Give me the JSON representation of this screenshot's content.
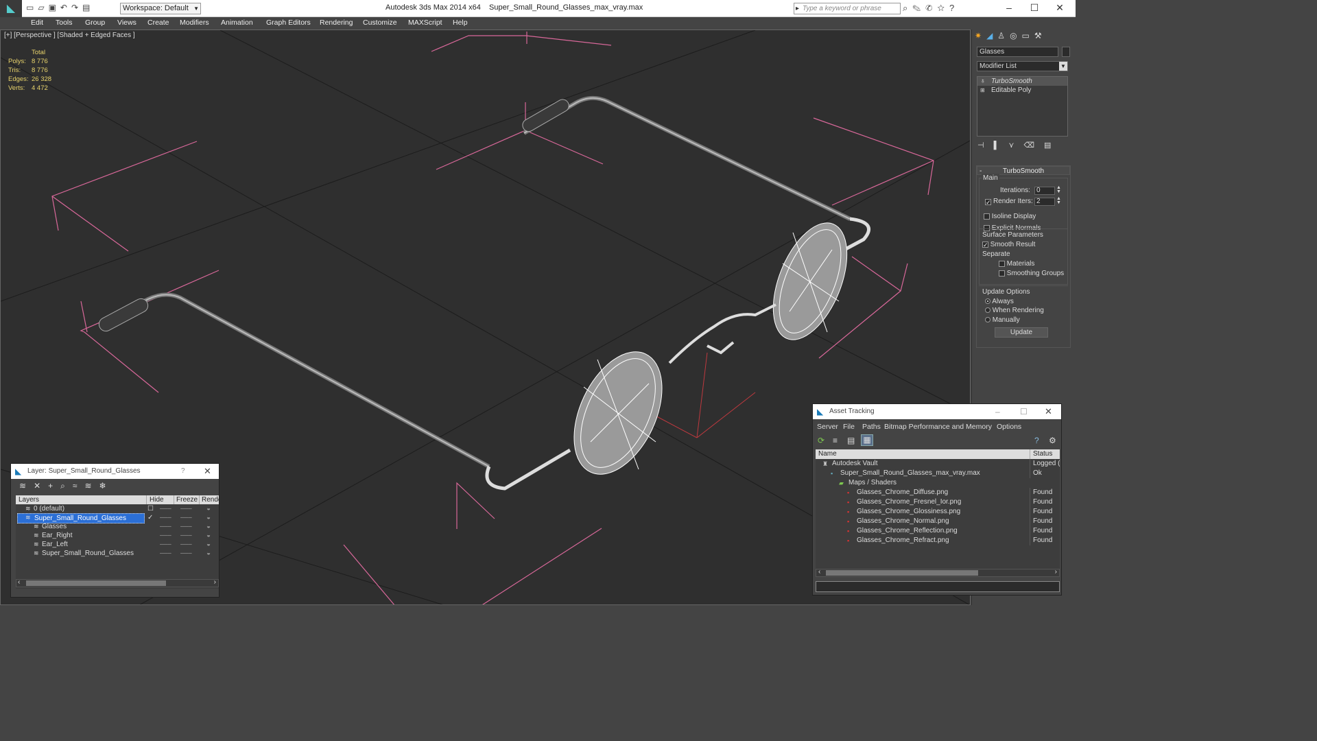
{
  "titlebar": {
    "workspace": "Workspace: Default",
    "app": "Autodesk 3ds Max  2014 x64",
    "file": "Super_Small_Round_Glasses_max_vray.max",
    "search_placeholder": "Type a keyword or phrase"
  },
  "menu": [
    "Edit",
    "Tools",
    "Group",
    "Views",
    "Create",
    "Modifiers",
    "Animation",
    "Graph Editors",
    "Rendering",
    "Customize",
    "MAXScript",
    "Help"
  ],
  "viewport": {
    "label": "[+] [Perspective ] [Shaded + Edged Faces ]",
    "stats": {
      "header": "Total",
      "rows": [
        {
          "k": "Polys:",
          "v": "8 776"
        },
        {
          "k": "Tris:",
          "v": "8 776"
        },
        {
          "k": "Edges:",
          "v": "26 328"
        },
        {
          "k": "Verts:",
          "v": "4 472"
        }
      ]
    }
  },
  "command_panel": {
    "object_name": "Glasses",
    "modifier_list": "Modifier List",
    "stack": [
      "TurboSmooth",
      "Editable Poly"
    ],
    "rollout": {
      "title": "TurboSmooth",
      "main": "Main",
      "iterations_label": "Iterations:",
      "iterations": "0",
      "render_iters_label": "Render Iters:",
      "render_iters": "2",
      "isoline": "Isoline Display",
      "explicit": "Explicit Normals",
      "surface": "Surface Parameters",
      "smooth": "Smooth Result",
      "separate": "Separate",
      "materials": "Materials",
      "smoothing_groups": "Smoothing Groups",
      "update_options": "Update Options",
      "always": "Always",
      "when_rendering": "When Rendering",
      "manually": "Manually",
      "update_btn": "Update"
    }
  },
  "layer_window": {
    "title": "Layer: Super_Small_Round_Glasses",
    "help": "?",
    "cols": [
      "Layers",
      "Hide",
      "Freeze",
      "Rende"
    ],
    "rows": [
      {
        "name": "0 (default)",
        "indent": 1
      },
      {
        "name": "Super_Small_Round_Glasses",
        "indent": 1,
        "selected": true
      },
      {
        "name": "Glasses",
        "indent": 2
      },
      {
        "name": "Ear_Right",
        "indent": 2
      },
      {
        "name": "Ear_Left",
        "indent": 2
      },
      {
        "name": "Super_Small_Round_Glasses",
        "indent": 2
      }
    ]
  },
  "asset_window": {
    "title": "Asset Tracking",
    "menu": [
      "Server",
      "File",
      "Paths",
      "Bitmap Performance and Memory",
      "Options"
    ],
    "cols": [
      "Name",
      "Status"
    ],
    "rows": [
      {
        "name": "Autodesk Vault",
        "status": "Logged (",
        "indent": 1
      },
      {
        "name": "Super_Small_Round_Glasses_max_vray.max",
        "status": "Ok",
        "indent": 2
      },
      {
        "name": "Maps / Shaders",
        "status": "",
        "indent": 3
      },
      {
        "name": "Glasses_Chrome_Diffuse.png",
        "status": "Found",
        "indent": 4
      },
      {
        "name": "Glasses_Chrome_Fresnel_Ior.png",
        "status": "Found",
        "indent": 4
      },
      {
        "name": "Glasses_Chrome_Glossiness.png",
        "status": "Found",
        "indent": 4
      },
      {
        "name": "Glasses_Chrome_Normal.png",
        "status": "Found",
        "indent": 4
      },
      {
        "name": "Glasses_Chrome_Reflection.png",
        "status": "Found",
        "indent": 4
      },
      {
        "name": "Glasses_Chrome_Refract.png",
        "status": "Found",
        "indent": 4
      }
    ]
  },
  "colors": {
    "viewport_bg": "#2f2f2f",
    "grid": "#1e1e1e",
    "bbox": "#e0709a",
    "stats": "#e8d36b",
    "wire": "#ffffff",
    "select": "#2b6fd6"
  }
}
